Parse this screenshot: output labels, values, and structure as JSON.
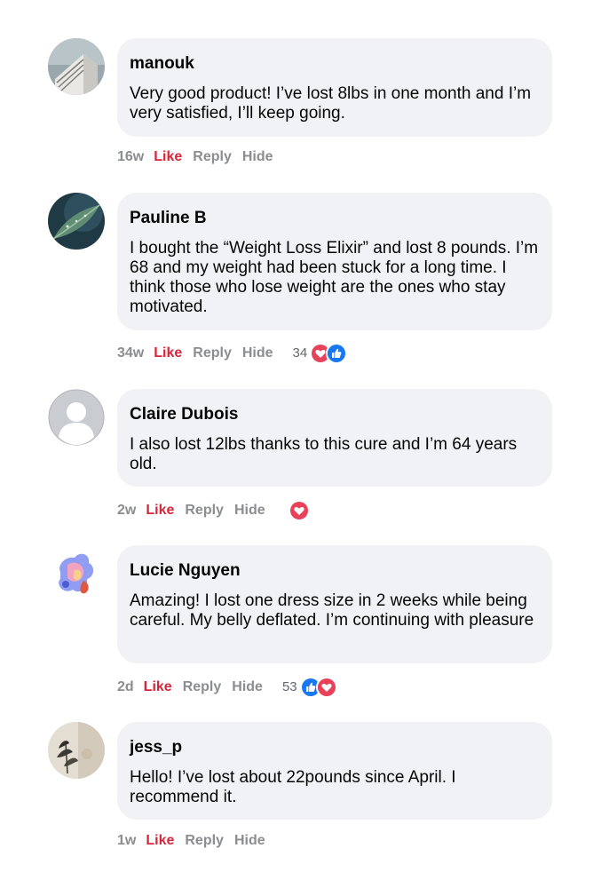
{
  "comments": [
    {
      "author": "manouk",
      "text": "Very good product! I’ve lost 8lbs in one month and I’m very satisfied, I’ll keep going.",
      "time": "16w",
      "like": "Like",
      "reply": "Reply",
      "hide": "Hide",
      "reaction_count": "",
      "reactions": []
    },
    {
      "author": "Pauline B",
      "text": "I bought the “Weight Loss Elixir” and lost 8 pounds. I’m 68 and my weight had been stuck for a long time. I think those who lose weight are the ones who stay motivated.",
      "time": "34w",
      "like": "Like",
      "reply": "Reply",
      "hide": "Hide",
      "reaction_count": "34",
      "reactions": [
        "love-icon",
        "like-icon"
      ]
    },
    {
      "author": "Claire Dubois",
      "text": "I also lost 12lbs thanks to this cure and I’m 64 years old.",
      "time": "2w",
      "like": "Like",
      "reply": "Reply",
      "hide": "Hide",
      "reaction_count": "",
      "reactions": [
        "love-icon"
      ]
    },
    {
      "author": "Lucie Nguyen",
      "text": "Amazing! I lost one dress size in 2 weeks while being careful. My belly deflated. I’m continuing with pleasure",
      "time": "2d",
      "like": "Like",
      "reply": "Reply",
      "hide": "Hide",
      "reaction_count": "53",
      "reactions": [
        "like-icon",
        "love-icon"
      ]
    },
    {
      "author": "jess_p",
      "text": "Hello! I’ve lost about 22pounds since April. I recommend it.",
      "time": "1w",
      "like": "Like",
      "reply": "Reply",
      "hide": "Hide",
      "reaction_count": "",
      "reactions": []
    }
  ],
  "colors": {
    "like_accent": "#d6263b",
    "bubble": "#f0f2f5",
    "love_reaction": "#e8425a",
    "like_reaction": "#1877f2"
  }
}
